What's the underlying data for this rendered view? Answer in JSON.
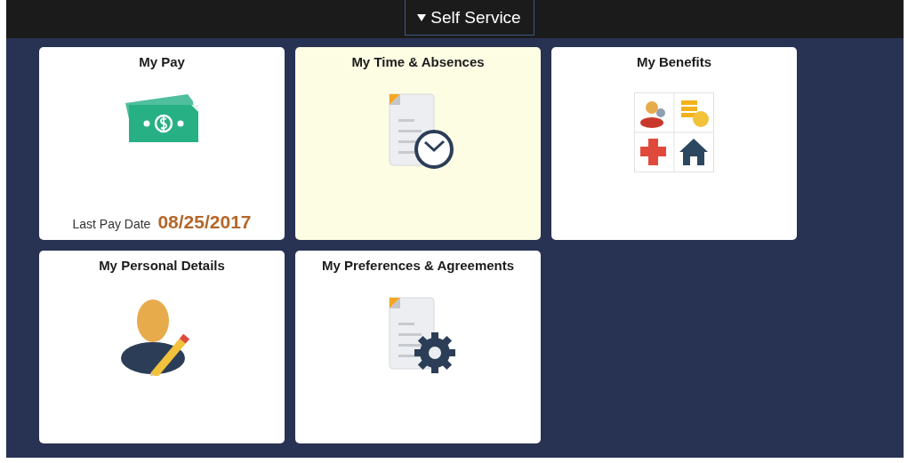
{
  "header": {
    "menu": {
      "label": "Self Service",
      "expanded": false
    }
  },
  "tiles": [
    {
      "title": "My Pay",
      "kind": "pay",
      "selected": false,
      "footer": {
        "label": "Last Pay Date",
        "value": "08/25/2017"
      }
    },
    {
      "title": "My Time & Absences",
      "kind": "time",
      "selected": true
    },
    {
      "title": "My Benefits",
      "kind": "benefits",
      "selected": false
    },
    {
      "title": "My Personal Details",
      "kind": "personal",
      "selected": false
    },
    {
      "title": "My Preferences & Agreements",
      "kind": "preferences",
      "selected": false
    }
  ]
}
